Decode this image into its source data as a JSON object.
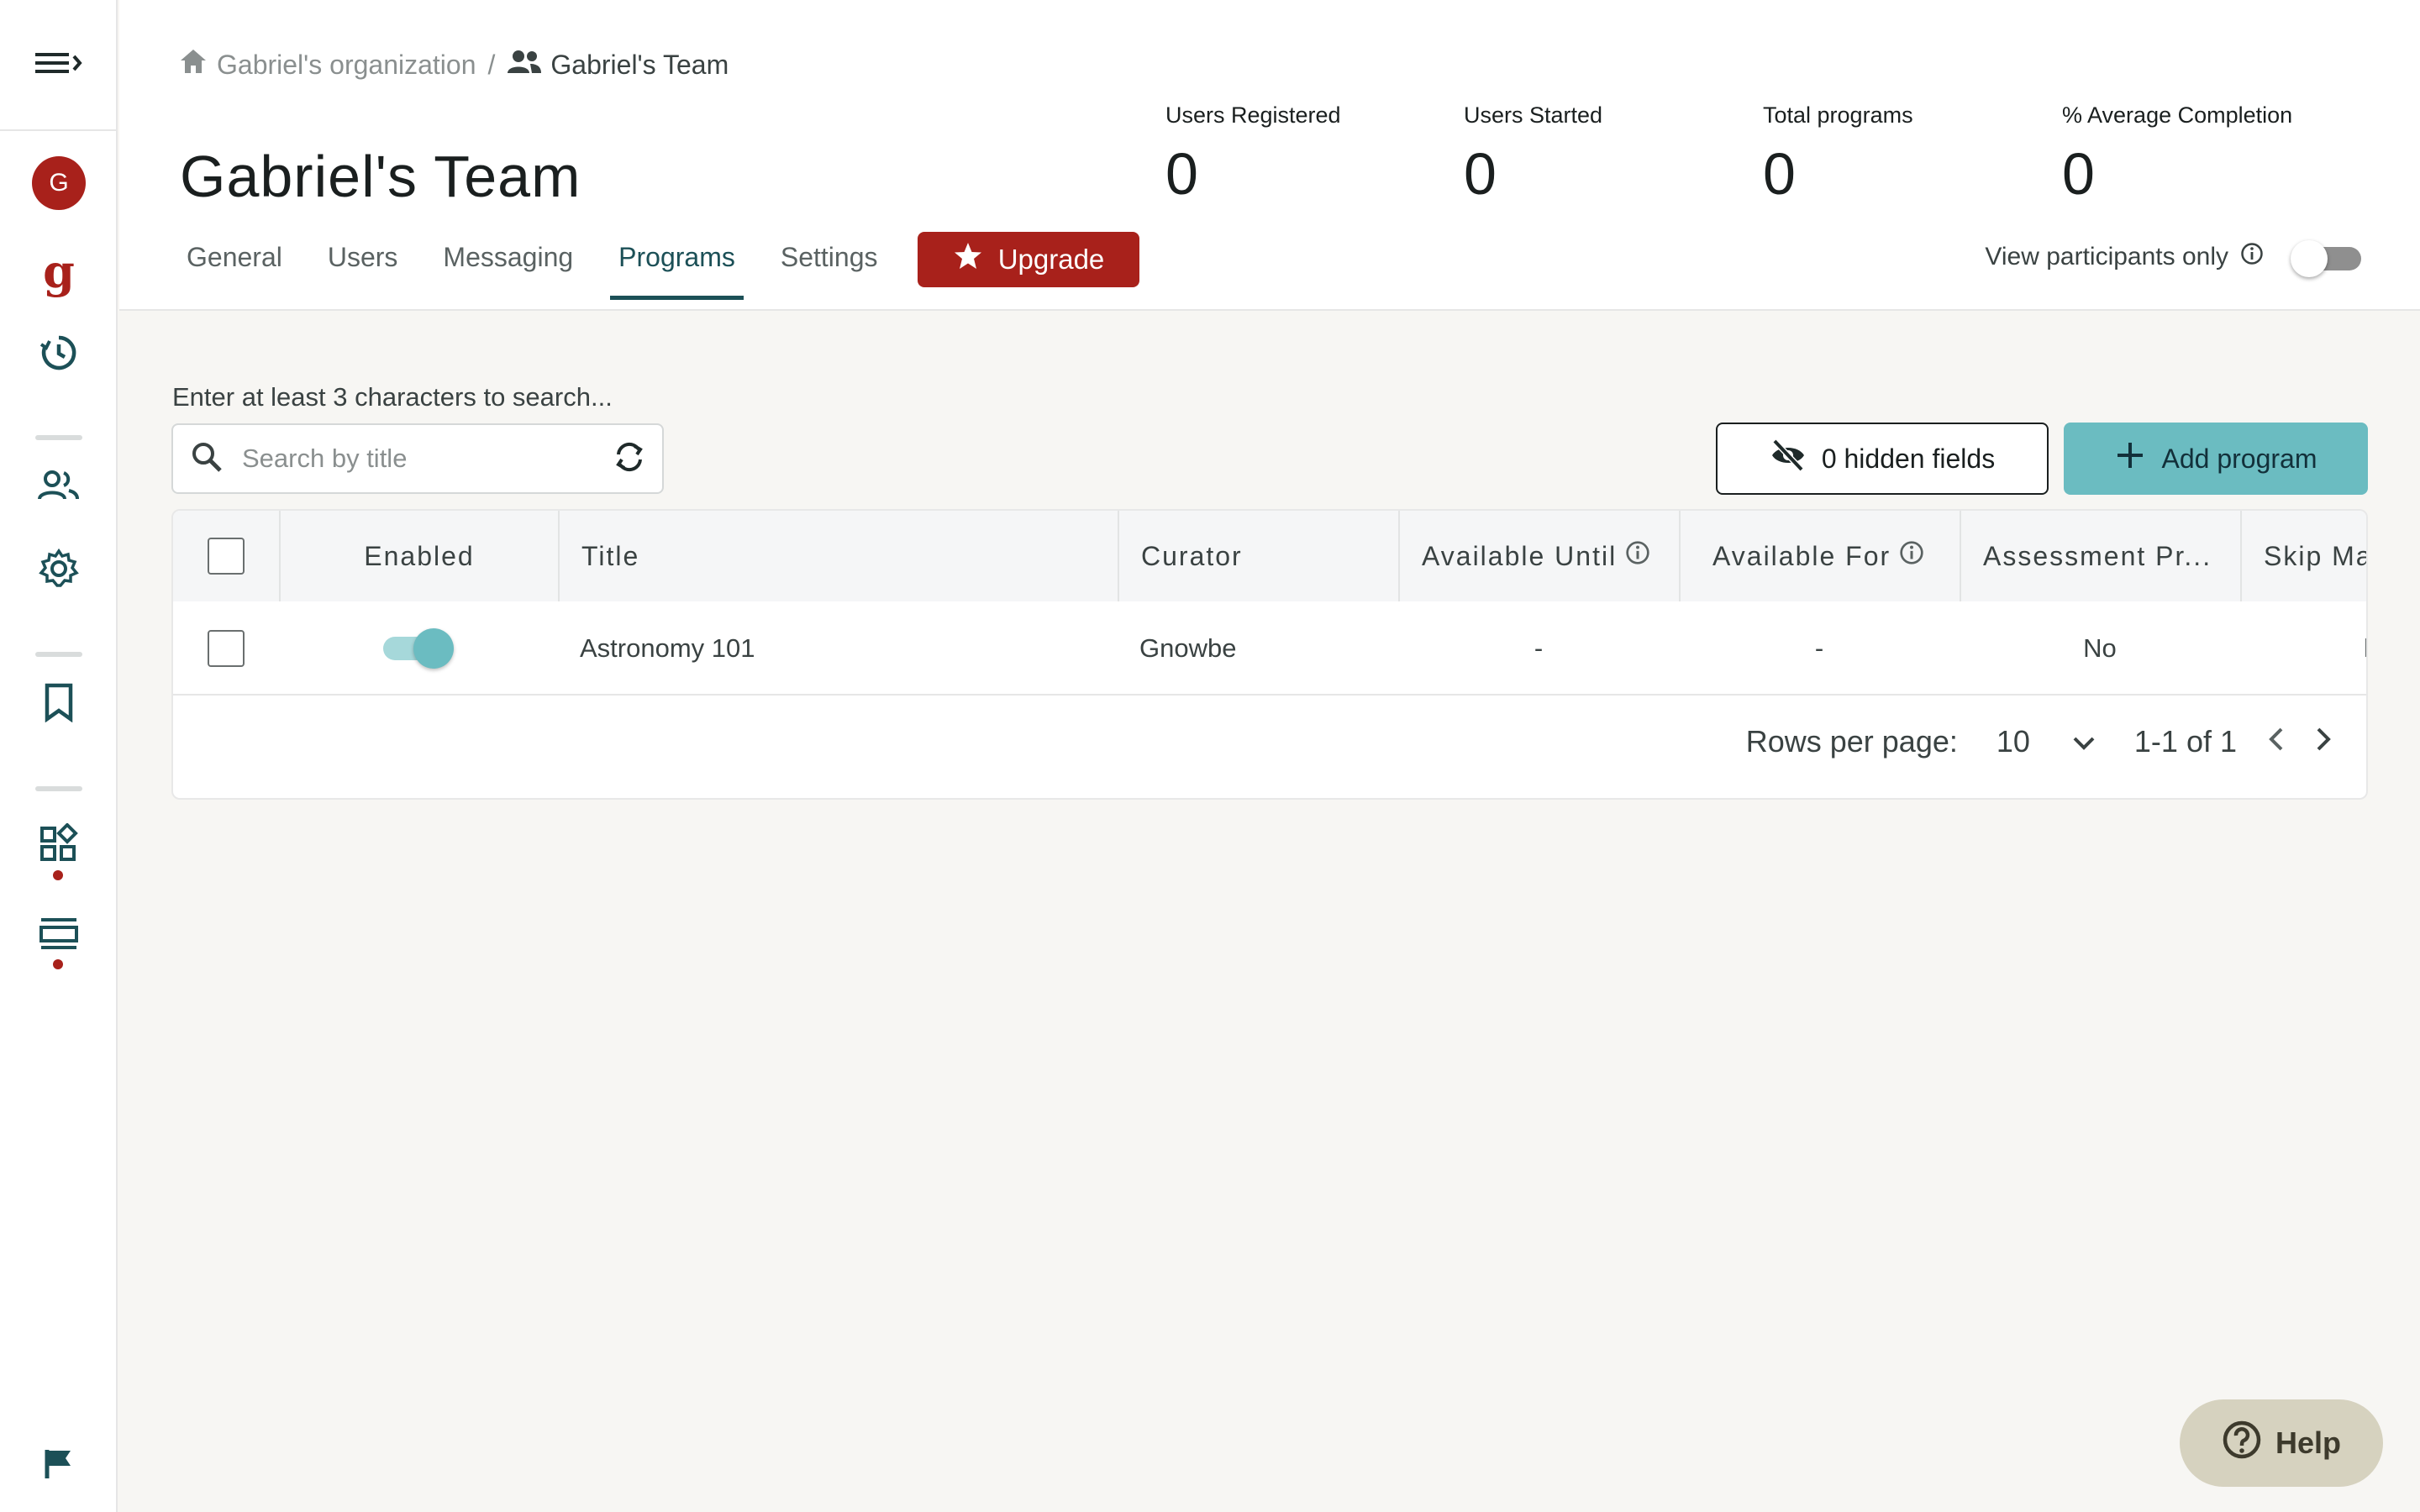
{
  "sidebar": {
    "avatar_letter": "G",
    "logo_letter": "g",
    "accent": "#a8211b",
    "teal": "#1c5057"
  },
  "breadcrumb": {
    "org": "Gabriel's organization",
    "separator": "/",
    "team": "Gabriel's Team"
  },
  "page": {
    "title": "Gabriel's Team"
  },
  "stats": [
    {
      "label": "Users Registered",
      "value": "0"
    },
    {
      "label": "Users Started",
      "value": "0"
    },
    {
      "label": "Total programs",
      "value": "0"
    },
    {
      "label": "% Average Completion",
      "value": "0"
    }
  ],
  "tabs": [
    {
      "label": "General",
      "active": false
    },
    {
      "label": "Users",
      "active": false
    },
    {
      "label": "Messaging",
      "active": false
    },
    {
      "label": "Programs",
      "active": true
    },
    {
      "label": "Settings",
      "active": false
    }
  ],
  "upgrade_label": "Upgrade",
  "view_participants": {
    "label": "View participants only",
    "enabled": false
  },
  "search": {
    "hint": "Enter at least 3 characters to search...",
    "placeholder": "Search by title"
  },
  "toolbar": {
    "hidden_fields_label": "0 hidden fields",
    "add_program_label": "Add program"
  },
  "table": {
    "columns": [
      "Enabled",
      "Title",
      "Curator",
      "Available Until",
      "Available For",
      "Assessment Pr...",
      "Skip Ma"
    ],
    "rows": [
      {
        "enabled": true,
        "title": "Astronomy 101",
        "curator": "Gnowbe",
        "available_until": "-",
        "available_for": "-",
        "assessment": "No",
        "skip": "l"
      }
    ]
  },
  "pagination": {
    "rows_per_page_label": "Rows per page:",
    "rows_per_page": "10",
    "range": "1-1 of 1"
  },
  "help_label": "Help"
}
